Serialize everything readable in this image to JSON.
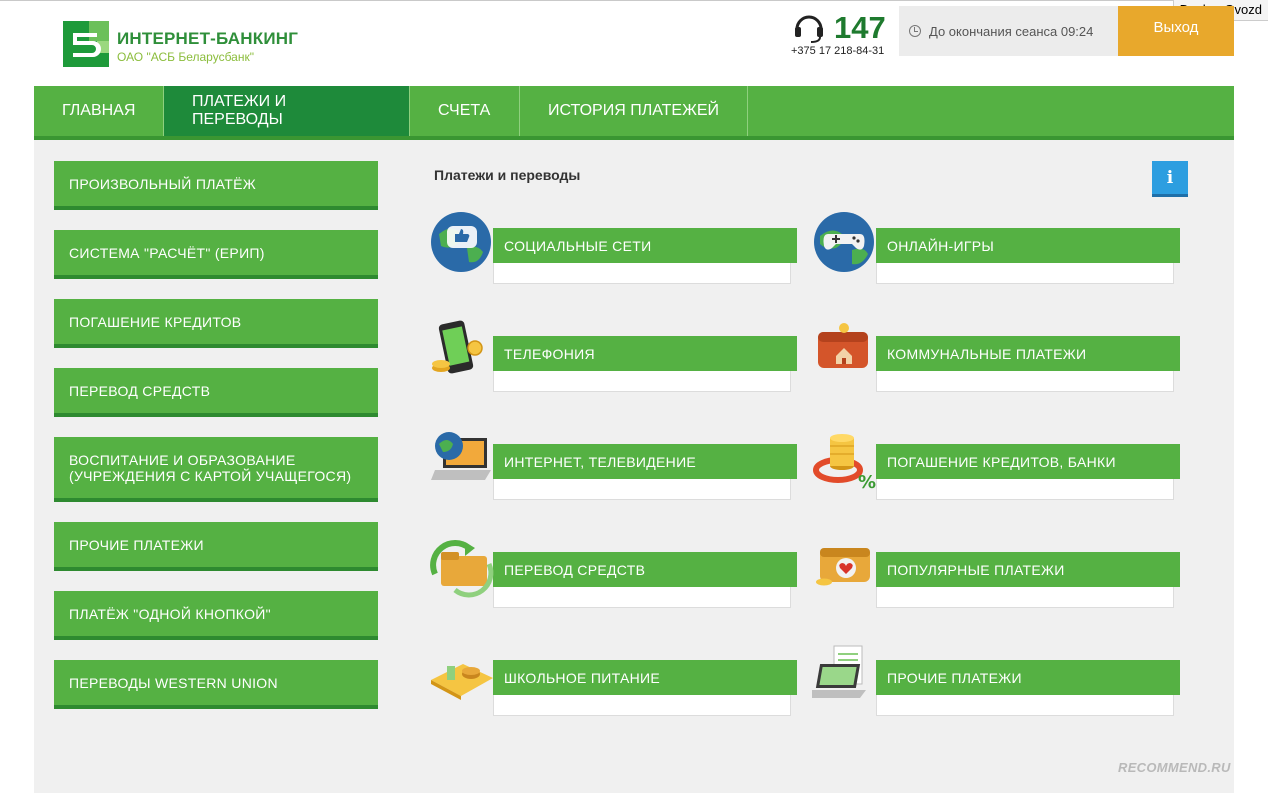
{
  "user": {
    "name": "Dasha_Gvozd"
  },
  "brand": {
    "title": "ИНТЕРНЕТ-БАНКИНГ",
    "subtitle": "ОАО \"АСБ Беларусбанк\""
  },
  "contact": {
    "short_number": "147",
    "phone": "+375 17 218-84-31"
  },
  "session": {
    "text": "До окончания сеанса 09:24"
  },
  "logout_label": "Выход",
  "nav": {
    "items": [
      {
        "label": "ГЛАВНАЯ"
      },
      {
        "label": "ПЛАТЕЖИ И ПЕРЕВОДЫ"
      },
      {
        "label": "СЧЕТА"
      },
      {
        "label": "ИСТОРИЯ ПЛАТЕЖЕЙ"
      }
    ]
  },
  "sidebar": {
    "items": [
      {
        "label": "ПРОИЗВОЛЬНЫЙ ПЛАТЁЖ"
      },
      {
        "label": "СИСТЕМА \"РАСЧЁТ\" (ЕРИП)"
      },
      {
        "label": "ПОГАШЕНИЕ КРЕДИТОВ"
      },
      {
        "label": "ПЕРЕВОД СРЕДСТВ"
      },
      {
        "label": "ВОСПИТАНИЕ И ОБРАЗОВАНИЕ",
        "label2": "(УЧРЕЖДЕНИЯ С КАРТОЙ УЧАЩЕГОСЯ)"
      },
      {
        "label": "ПРОЧИЕ ПЛАТЕЖИ"
      },
      {
        "label": "ПЛАТЁЖ \"ОДНОЙ КНОПКОЙ\""
      },
      {
        "label": "ПЕРЕВОДЫ WESTERN UNION"
      }
    ]
  },
  "main": {
    "title": "Платежи и переводы",
    "info_label": "i",
    "tiles": [
      {
        "label": "СОЦИАЛЬНЫЕ СЕТИ",
        "icon": "social-networks-globe-icon"
      },
      {
        "label": "ОНЛАЙН-ИГРЫ",
        "icon": "online-games-globe-icon"
      },
      {
        "label": "ТЕЛЕФОНИЯ",
        "icon": "smartphone-icon"
      },
      {
        "label": "КОММУНАЛЬНЫЕ ПЛАТЕЖИ",
        "icon": "wallet-house-icon"
      },
      {
        "label": "ИНТЕРНЕТ, ТЕЛЕВИДЕНИЕ",
        "icon": "laptop-globe-icon"
      },
      {
        "label": "ПОГАШЕНИЕ КРЕДИТОВ, БАНКИ",
        "icon": "coins-percent-icon"
      },
      {
        "label": "ПЕРЕВОД СРЕДСТВ",
        "icon": "folder-transfer-icon"
      },
      {
        "label": "ПОПУЛЯРНЫЕ ПЛАТЕЖИ",
        "icon": "wallet-heart-icon"
      },
      {
        "label": "ШКОЛЬНОЕ ПИТАНИЕ",
        "icon": "school-lunch-tray-icon"
      },
      {
        "label": "ПРОЧИЕ ПЛАТЕЖИ",
        "icon": "laptop-other-icon"
      }
    ]
  },
  "watermark": "RECOMMEND.RU"
}
